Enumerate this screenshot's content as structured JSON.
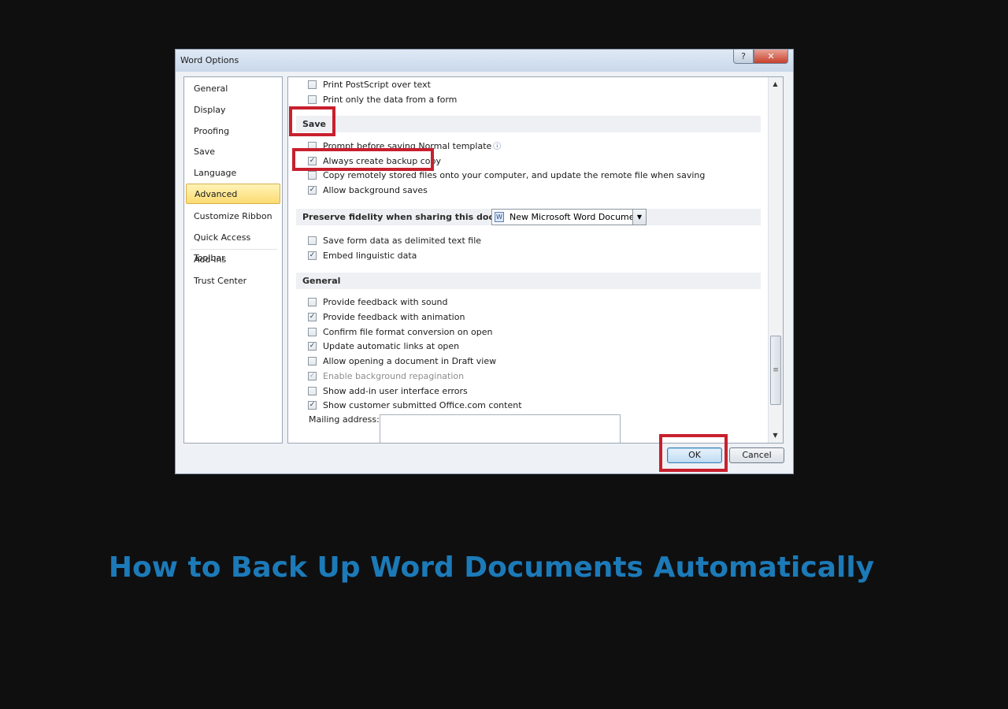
{
  "window": {
    "title": "Word Options",
    "help_label": "?",
    "close_label": "✕"
  },
  "nav": {
    "items": [
      "General",
      "Display",
      "Proofing",
      "Save",
      "Language",
      "Advanced",
      "Customize Ribbon",
      "Quick Access Toolbar",
      "Add-Ins",
      "Trust Center"
    ],
    "selected": "Advanced"
  },
  "content": {
    "print_rows": [
      {
        "label": "Print PostScript over text",
        "checked": false
      },
      {
        "label": "Print only the data from a form",
        "checked": false
      }
    ],
    "save_section": {
      "title": "Save",
      "rows": [
        {
          "label": "Prompt before saving Normal template",
          "checked": false,
          "info": "ⓘ"
        },
        {
          "label": "Always create backup copy",
          "checked": true
        },
        {
          "label": "Copy remotely stored files onto your computer, and update the remote file when saving",
          "checked": false
        },
        {
          "label": "Allow background saves",
          "checked": true
        }
      ]
    },
    "fidelity_section": {
      "title": "Preserve fidelity when sharing this document:",
      "document": "New Microsoft Word Document",
      "rows": [
        {
          "label": "Save form data as delimited text file",
          "checked": false
        },
        {
          "label": "Embed linguistic data",
          "checked": true
        }
      ]
    },
    "general_section": {
      "title": "General",
      "rows": [
        {
          "label": "Provide feedback with sound",
          "checked": false
        },
        {
          "label": "Provide feedback with animation",
          "checked": true
        },
        {
          "label": "Confirm file format conversion on open",
          "checked": false
        },
        {
          "label": "Update automatic links at open",
          "checked": true
        },
        {
          "label": "Allow opening a document in Draft view",
          "checked": false
        },
        {
          "label": "Enable background repagination",
          "checked": true,
          "disabled": true
        },
        {
          "label": "Show add-in user interface errors",
          "checked": false
        },
        {
          "label": "Show customer submitted Office.com content",
          "checked": true
        }
      ],
      "mailing_label": "Mailing address:",
      "mailing_value": ""
    }
  },
  "buttons": {
    "ok": "OK",
    "cancel": "Cancel"
  },
  "headline": "How to Back Up Word Documents Automatically",
  "colors": {
    "highlight": "#c8202e",
    "headline": "#1c7ab8",
    "background": "#0f0f10"
  }
}
